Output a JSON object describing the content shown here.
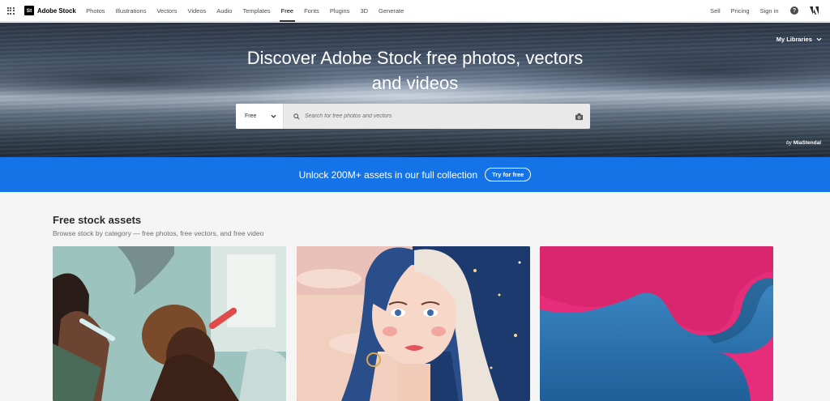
{
  "nav": {
    "brand_badge": "St",
    "brand": "Adobe Stock",
    "links": [
      "Photos",
      "Illustrations",
      "Vectors",
      "Videos",
      "Audio",
      "Templates",
      "Free",
      "Fonts",
      "Plugins",
      "3D",
      "Generate"
    ],
    "active": "Free",
    "right": {
      "sell": "Sell",
      "pricing": "Pricing",
      "signin": "Sign in",
      "help": "?"
    }
  },
  "hero": {
    "title_line1": "Discover Adobe Stock free photos, vectors",
    "title_line2": "and videos",
    "my_libraries": "My Libraries",
    "search": {
      "filter_value": "Free",
      "placeholder": "Search for free photos and vectors"
    },
    "credit_prefix": "by",
    "credit_name": "MiaStendal"
  },
  "banner": {
    "text": "Unlock 200M+ assets in our full collection",
    "button": "Try for free",
    "color": "#1473e6"
  },
  "section": {
    "title": "Free stock assets",
    "subtitle": "Browse stock by category — free photos, free vectors, and free video",
    "cards": [
      {
        "kind": "photo"
      },
      {
        "kind": "vector"
      },
      {
        "kind": "abstract"
      }
    ]
  }
}
